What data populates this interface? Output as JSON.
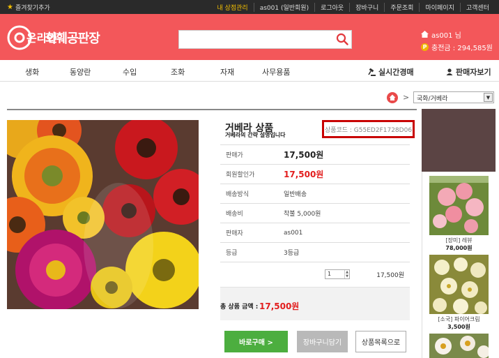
{
  "topbar": {
    "favorites_label": "즐겨찾기추가",
    "links": [
      "내 상점관리",
      "as001 (일반회원)",
      "로그아웃",
      "장바구니",
      "주문조회",
      "마이페이지",
      "고객센터"
    ]
  },
  "header": {
    "logo_mark": "온라인",
    "logo_text": "화훼공판장",
    "search": {
      "value": "",
      "placeholder": ""
    },
    "user_name": "as001 님",
    "points": "충전금 : 294,585원"
  },
  "nav": {
    "items": [
      "생화",
      "동양란",
      "수입",
      "조화",
      "자재",
      "사무용품"
    ],
    "live_auction": "실시간경매",
    "seller_view": "판매자보기"
  },
  "breadcrumb": {
    "separator": ">",
    "selected": "국화/거베라"
  },
  "product": {
    "title": "거베라 상품",
    "description": "거베라의 간략 설명입니다",
    "code": "상품코드 : G55ED2F1728D06",
    "rows": [
      {
        "label": "판매가",
        "value": "17,500원"
      },
      {
        "label": "회원할인가",
        "value": "17,500원"
      },
      {
        "label": "배송방식",
        "value": "일반배송"
      },
      {
        "label": "배송비",
        "value": "착불 5,000원"
      },
      {
        "label": "판매자",
        "value": "as001"
      },
      {
        "label": "등급",
        "value": "3등급"
      }
    ],
    "quantity": "1",
    "line_price": "17,500원",
    "total_label": "총 상품 금액 :",
    "total_amount": "17,500원"
  },
  "buttons": {
    "buy": "바로구매  >",
    "cart": "장바구니담기",
    "list": "상품목록으로"
  },
  "side": {
    "items": [
      {
        "name": "[장미] 레뷰",
        "price": "78,000원"
      },
      {
        "name": "[소국] 파이어크림",
        "price": "3,500원"
      }
    ]
  },
  "colors": {
    "brand": "#f3575a",
    "price_red": "#e21d1d",
    "buy_green": "#4cae3f",
    "code_border": "#c80000"
  }
}
